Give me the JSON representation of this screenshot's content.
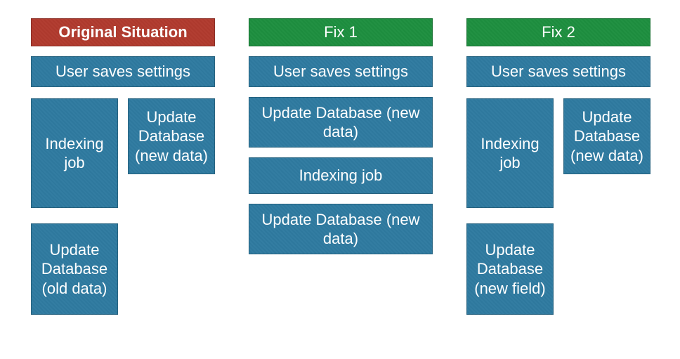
{
  "colors": {
    "red": "#b03a2e",
    "green": "#1e8f3f",
    "blue": "#2f7aa0",
    "text": "#ffffff"
  },
  "columns": [
    {
      "header": "Original Situation",
      "headerStyle": "red",
      "sub": "User saves settings",
      "blocks": [
        {
          "id": "c1a",
          "text": "Indexing job",
          "width": "half"
        },
        {
          "id": "c1b",
          "text": "Update Database (new data)",
          "width": "half"
        },
        {
          "id": "c1c",
          "text": "Update Database (old data)",
          "width": "half"
        }
      ]
    },
    {
      "header": "Fix 1",
      "headerStyle": "green",
      "sub": "User saves settings",
      "blocks": [
        {
          "id": "c2a",
          "text": "Update Database (new data)",
          "width": "full"
        },
        {
          "id": "c2b",
          "text": "Indexing job",
          "width": "full"
        },
        {
          "id": "c2c",
          "text": "Update Database (new data)",
          "width": "full"
        }
      ]
    },
    {
      "header": "Fix 2",
      "headerStyle": "green",
      "sub": "User saves settings",
      "blocks": [
        {
          "id": "c3a",
          "text": "Indexing job",
          "width": "half"
        },
        {
          "id": "c3b",
          "text": "Update Database (new data)",
          "width": "half"
        },
        {
          "id": "c3c",
          "text": "Update Database (new field)",
          "width": "half"
        }
      ]
    }
  ]
}
